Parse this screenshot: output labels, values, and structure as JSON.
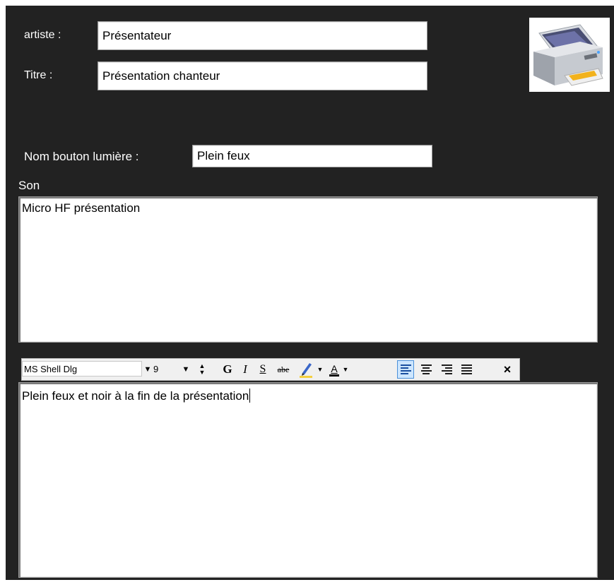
{
  "form": {
    "artist_label": "artiste :",
    "artist_value": "Présentateur",
    "title_label": "Titre :",
    "title_value": "Présentation chanteur",
    "light_button_label": "Nom bouton lumière :",
    "light_button_value": "Plein feux",
    "sound_label": "Son",
    "sound_text": "Micro HF présentation",
    "notes_text": "Plein feux et noir à la fin de la présentation"
  },
  "toolbar": {
    "font_name": "MS Shell Dlg",
    "font_size": "9",
    "bold_glyph": "G",
    "italic_glyph": "I",
    "underline_glyph": "S",
    "strike_glyph": "abe",
    "highlight_underline_color": "#f4d03f",
    "text_color_glyph": "A",
    "clear_glyph": "×",
    "active_alignment": "left"
  },
  "printer_icon": "printer-icon"
}
